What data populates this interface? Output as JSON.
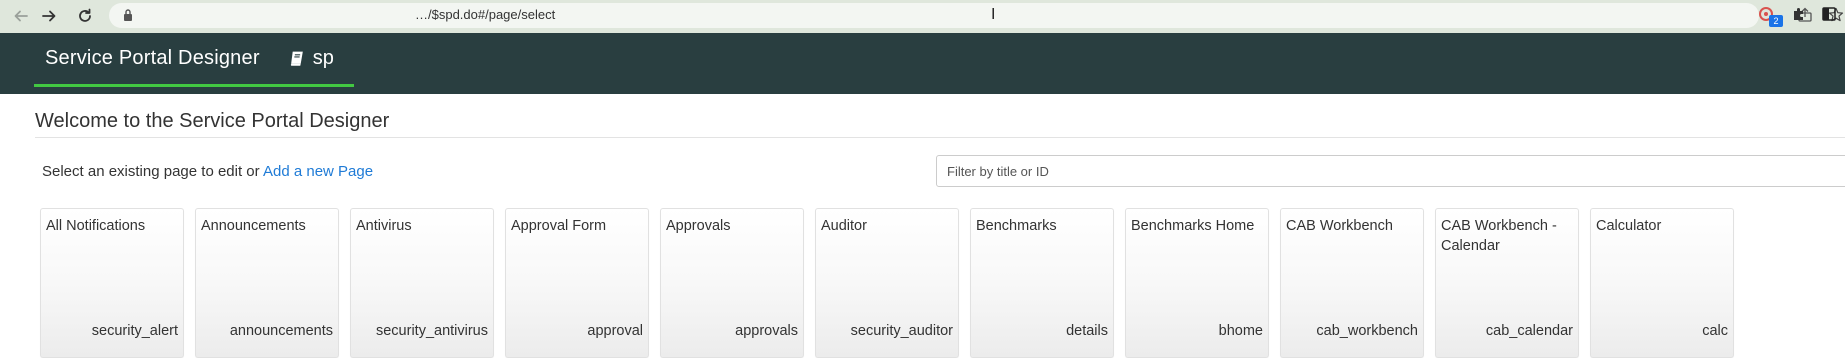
{
  "browser": {
    "url": "…/$spd.do#/page/select",
    "extension_badge": "2",
    "icons": [
      "back-icon",
      "forward-icon",
      "reload-icon",
      "lock-icon",
      "share-icon",
      "star-icon",
      "extension-icon",
      "puzzle-icon",
      "side-panel-icon"
    ]
  },
  "header": {
    "title": "Service Portal Designer",
    "scope_icon": "book-icon",
    "scope": "sp",
    "colors": {
      "background": "#293e40",
      "underline": "#42c842"
    }
  },
  "main": {
    "heading": "Welcome to the Service Portal Designer",
    "select_prefix": "Select an existing page to edit or ",
    "add_link": "Add a new Page",
    "filter_placeholder": "Filter by title or ID",
    "link_color": "#1f7bd6"
  },
  "pages": [
    {
      "title": "All Notifications",
      "id": "security_alert"
    },
    {
      "title": "Announcements",
      "id": "announcements"
    },
    {
      "title": "Antivirus",
      "id": "security_antivirus"
    },
    {
      "title": "Approval Form",
      "id": "approval"
    },
    {
      "title": "Approvals",
      "id": "approvals"
    },
    {
      "title": "Auditor",
      "id": "security_auditor"
    },
    {
      "title": "Benchmarks",
      "id": "details"
    },
    {
      "title": "Benchmarks Home",
      "id": "bhome"
    },
    {
      "title": "CAB Workbench",
      "id": "cab_workbench"
    },
    {
      "title": "CAB Workbench - Calendar",
      "id": "cab_calendar"
    },
    {
      "title": "Calculator",
      "id": "calc"
    }
  ]
}
